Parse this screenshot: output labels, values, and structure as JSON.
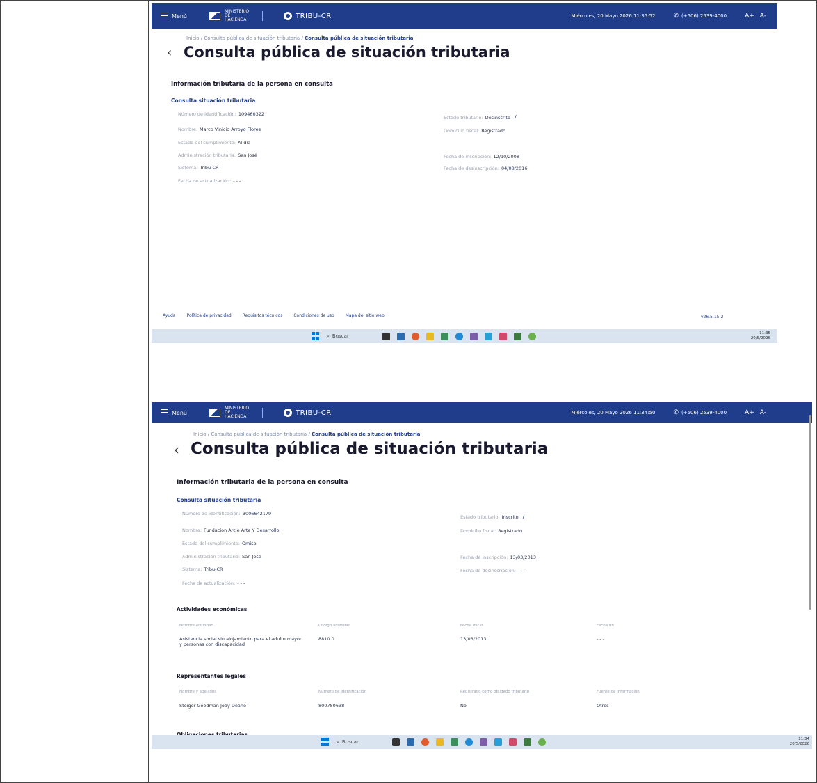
{
  "topbar": {
    "menu_label": "Menú",
    "ministry": "MINISTERIO DE HACIENDA",
    "brand": "TRIBU-CR",
    "phone": "(+506) 2539-4000",
    "font_up": "A+",
    "font_down": "A-"
  },
  "screen1": {
    "datetime": "Miércoles, 20 Mayo 2026 11:35:52",
    "breadcrumb_home": "Inicio",
    "breadcrumb_mid": "Consulta pública de situación tributaria",
    "breadcrumb_current": "Consulta pública de situación tributaria",
    "title": "Consulta pública de situación tributaria",
    "section": "Información tributaria de la persona en consulta",
    "subsection": "Consulta situación tributaria",
    "fields": [
      {
        "label": "Número de identificación:",
        "value": "109460322"
      },
      {
        "label": "Nombre:",
        "value": "Marco Vinicio Arroyo Flores"
      },
      {
        "label": "Estado del cumplimiento:",
        "value": "Al día"
      },
      {
        "label": "Administración tributaria:",
        "value": "San José"
      },
      {
        "label": "Sistema:",
        "value": "Tribu-CR"
      },
      {
        "label": "Fecha de actualización:",
        "value": "- - -"
      }
    ],
    "fields_right": [
      {
        "label": "Estado tributario:",
        "value": "Desinscrito"
      },
      {
        "label": "Domicilio fiscal:",
        "value": "Registrado"
      },
      {
        "label": "Fecha de inscripción:",
        "value": "12/10/2008"
      },
      {
        "label": "Fecha de desinscripción:",
        "value": "04/08/2016"
      }
    ],
    "footer_links": [
      "Ayuda",
      "Política de privacidad",
      "Requisitos técnicos",
      "Condiciones de uso",
      "Mapa del sitio web"
    ],
    "version": "v26.5.15-2",
    "taskbar_search": "Buscar",
    "clock_time": "11:35",
    "clock_date": "20/5/2026"
  },
  "screen2": {
    "datetime": "Miércoles, 20 Mayo 2026 11:34:50",
    "breadcrumb_home": "Inicio",
    "breadcrumb_mid": "Consulta pública de situación tributaria",
    "breadcrumb_current": "Consulta pública de situación tributaria",
    "title": "Consulta pública de situación tributaria",
    "section": "Información tributaria de la persona en consulta",
    "subsection": "Consulta situación tributaria",
    "fields": [
      {
        "label": "Número de identificación:",
        "value": "3006642179"
      },
      {
        "label": "Nombre:",
        "value": "Fundacion Arcie Arte Y Desarrollo"
      },
      {
        "label": "Estado del cumplimiento:",
        "value": "Omiso"
      },
      {
        "label": "Administración tributaria:",
        "value": "San José"
      },
      {
        "label": "Sistema:",
        "value": "Tribu-CR"
      },
      {
        "label": "Fecha de actualización:",
        "value": "- - -"
      }
    ],
    "fields_right": [
      {
        "label": "Estado tributario:",
        "value": "Inscrito"
      },
      {
        "label": "Domicilio fiscal:",
        "value": "Registrado"
      },
      {
        "label": "Fecha de inscripción:",
        "value": "13/03/2013"
      },
      {
        "label": "Fecha de desinscripción:",
        "value": "- - -"
      }
    ],
    "activities": {
      "title": "Actividades económicas",
      "headers": [
        "Nombre actividad",
        "Código actividad",
        "Fecha inicio",
        "Fecha fin"
      ],
      "row": [
        "Asistencia social sin alojamiento para el adulto mayor y personas con discapacidad",
        "8810.0",
        "13/03/2013",
        "- - -"
      ]
    },
    "representatives": {
      "title": "Representantes legales",
      "headers": [
        "Nombre y apellidos",
        "Número de identificación",
        "Registrado como obligado tributario",
        "Fuente de información"
      ],
      "row": [
        "Steiger Goodman Jody Deane",
        "800780638",
        "No",
        "Otros"
      ]
    },
    "next_section": "Obligaciones tributarias",
    "taskbar_search": "Buscar",
    "clock_time": "11:34",
    "clock_date": "20/5/2026"
  }
}
